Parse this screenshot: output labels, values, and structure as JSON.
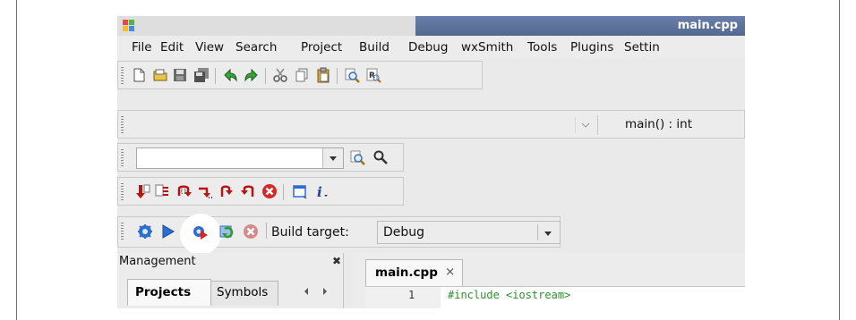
{
  "window": {
    "title": "main.cpp"
  },
  "menu": [
    "File",
    "Edit",
    "View",
    "Search",
    "Project",
    "Build",
    "Debug",
    "wxSmith",
    "Tools",
    "Plugins",
    "Settin"
  ],
  "code_toolbar": {
    "function_label": "main() : int"
  },
  "build_toolbar": {
    "target_label": "Build target:",
    "target_value": "Debug"
  },
  "management": {
    "title": "Management",
    "tabs": [
      "Projects",
      "Symbols"
    ],
    "close_glyph": "✖"
  },
  "editor": {
    "tab_label": "main.cpp",
    "tab_close": "×",
    "line_number": "1",
    "code_line": "#include <iostream>"
  },
  "icons": {
    "main_toolbar": [
      "new-file-icon",
      "open-folder-icon",
      "save-icon",
      "save-all-icon",
      "undo-icon",
      "redo-icon",
      "cut-icon",
      "copy-icon",
      "paste-icon",
      "find-icon",
      "replace-icon"
    ],
    "debug_toolbar": [
      "debug-run-icon",
      "run-to-cursor-icon",
      "next-line-icon",
      "step-into-icon",
      "step-out-icon",
      "next-instruction-icon",
      "stop-debug-icon",
      "debug-window-icon",
      "info-icon"
    ],
    "build_toolbar": [
      "build-icon",
      "run-icon",
      "build-and-run-icon",
      "rebuild-icon",
      "abort-icon"
    ]
  },
  "colors": {
    "titlebar": "#5c7197",
    "code_green": "#2d8f2d",
    "debug_red": "#b51515",
    "accent_blue": "#2d6fd0"
  }
}
